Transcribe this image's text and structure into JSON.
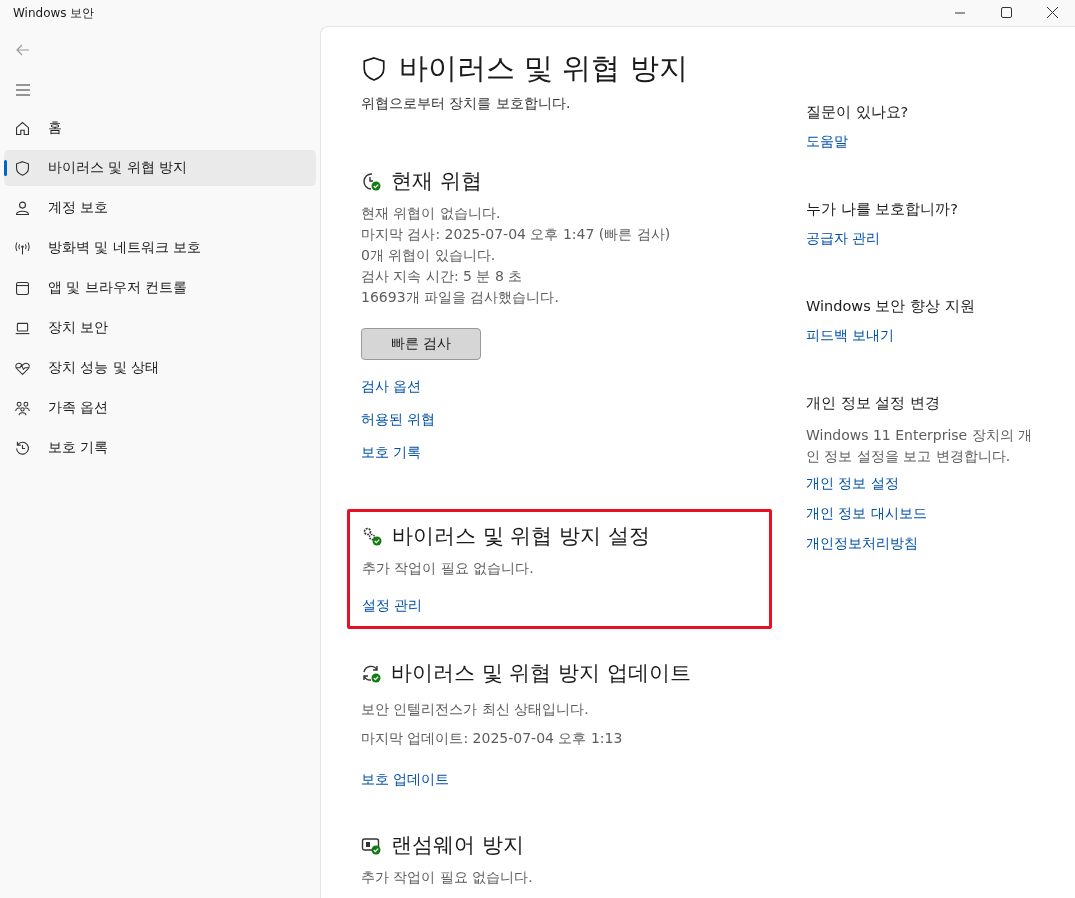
{
  "window": {
    "title": "Windows 보안"
  },
  "sidebar": {
    "items": [
      {
        "kind": "home",
        "label": "홈",
        "selected": false
      },
      {
        "kind": "shield",
        "label": "바이러스 및 위협 방지",
        "selected": true
      },
      {
        "kind": "person",
        "label": "계정 보호",
        "selected": false
      },
      {
        "kind": "antenna",
        "label": "방화벽 및 네트워크 보호",
        "selected": false
      },
      {
        "kind": "browser",
        "label": "앱 및 브라우저 컨트롤",
        "selected": false
      },
      {
        "kind": "laptop",
        "label": "장치 보안",
        "selected": false
      },
      {
        "kind": "heart",
        "label": "장치 성능 및 상태",
        "selected": false
      },
      {
        "kind": "family",
        "label": "가족 옵션",
        "selected": false
      },
      {
        "kind": "history",
        "label": "보호 기록",
        "selected": false
      }
    ]
  },
  "page": {
    "title": "바이러스 및 위협 방지",
    "subtitle": "위협으로부터 장치를 보호합니다."
  },
  "sections": [
    {
      "kind": "threats",
      "title": "현재 위협",
      "highlighted": false,
      "lines": [
        "현재 위협이 없습니다.",
        "마지막 검사: 2025-07-04 오후 1:47 (빠른 검사)",
        "0개 위협이 있습니다.",
        "검사 지속 시간: 5 분 8 초",
        "16693개 파일을 검사했습니다."
      ],
      "button": "빠른 검사",
      "links": [
        "검사 옵션",
        "허용된 위협",
        "보호 기록"
      ]
    },
    {
      "kind": "settings",
      "title": "바이러스 및 위협 방지 설정",
      "highlighted": true,
      "lines": [
        "추가 작업이 필요 없습니다."
      ],
      "links": [
        "설정 관리"
      ]
    },
    {
      "kind": "updates",
      "title": "바이러스 및 위협 방지 업데이트",
      "highlighted": false,
      "lines": [
        "보안 인텔리전스가 최신 상태입니다.",
        "마지막 업데이트: 2025-07-04 오후 1:13"
      ],
      "links": [
        "보호 업데이트"
      ]
    },
    {
      "kind": "ransomware",
      "title": "랜섬웨어 방지",
      "highlighted": false,
      "lines": [
        "추가 작업이 필요 없습니다."
      ]
    }
  ],
  "aside": [
    {
      "heading": "질문이 있나요?",
      "links": [
        "도움말"
      ]
    },
    {
      "heading": "누가 나를 보호합니까?",
      "links": [
        "공급자 관리"
      ]
    },
    {
      "heading": "Windows 보안 향상 지원",
      "links": [
        "피드백 보내기"
      ]
    },
    {
      "heading": "개인 정보 설정 변경",
      "description": "Windows 11 Enterprise 장치의 개인 정보 설정을 보고 변경합니다.",
      "links": [
        "개인 정보 설정",
        "개인 정보 대시보드",
        "개인정보처리방침"
      ]
    }
  ]
}
